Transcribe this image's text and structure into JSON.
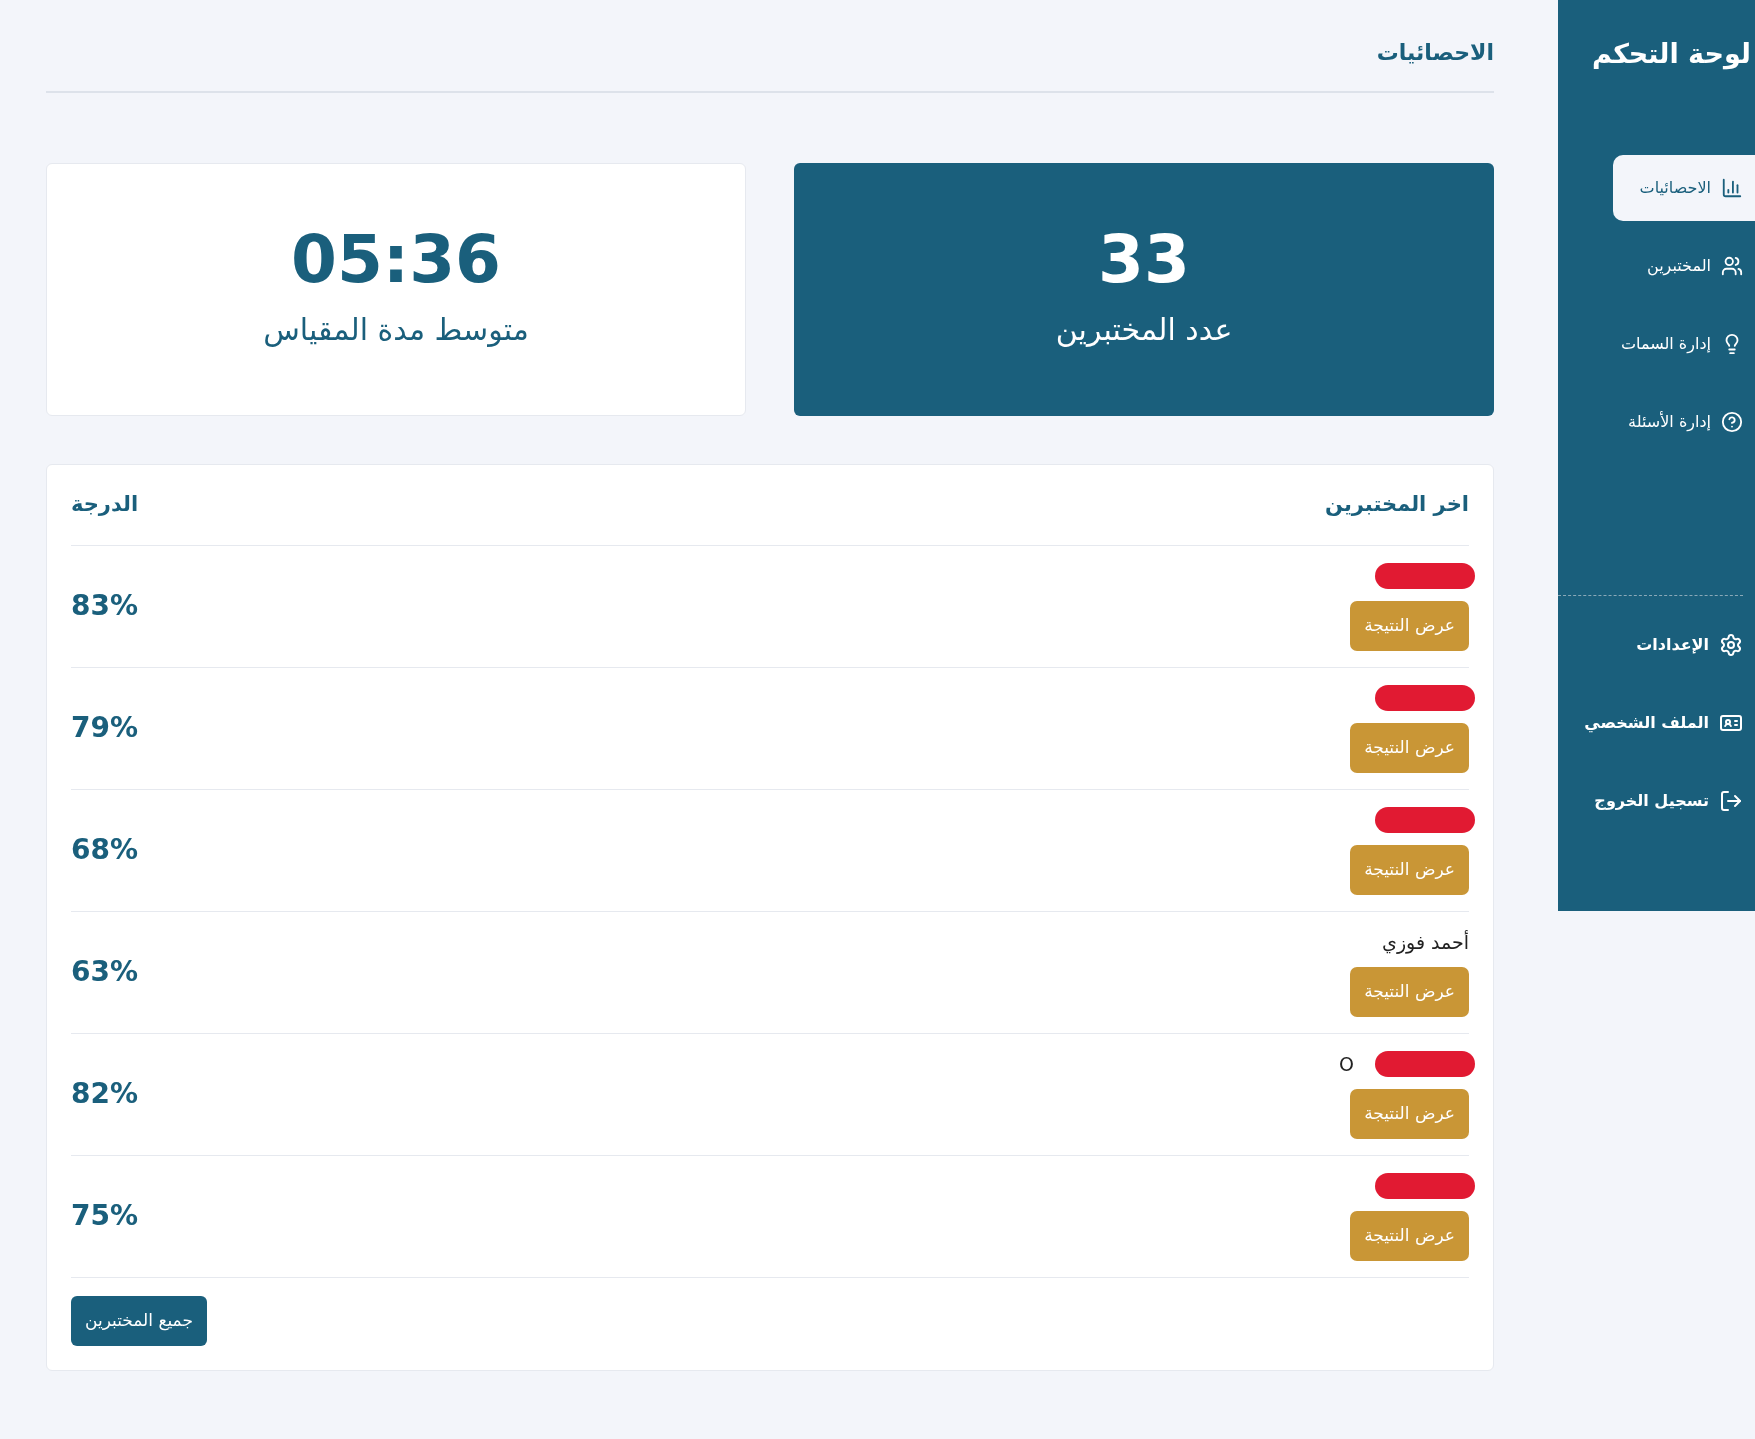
{
  "sidebar": {
    "title": "لوحة التحكم",
    "items": [
      {
        "label": "الاحصائيات",
        "selected": true
      },
      {
        "label": "المختبرين",
        "selected": false
      },
      {
        "label": "إدارة السمات",
        "selected": false
      },
      {
        "label": "إدارة الأسئلة",
        "selected": false
      }
    ],
    "bottom_items": [
      {
        "label": "الإعدادات"
      },
      {
        "label": "الملف الشخصي"
      },
      {
        "label": "تسجيل الخروج"
      }
    ]
  },
  "header": {
    "title": "الاحصائيات"
  },
  "stats": [
    {
      "value": "33",
      "label": "عدد المختبرين",
      "highlighted": true
    },
    {
      "value": "05:36",
      "label": "متوسط مدة المقياس",
      "highlighted": false
    }
  ],
  "table": {
    "columns": [
      "اخر المختبرين",
      "الدرجة"
    ],
    "rows": [
      {
        "name": "",
        "redacted": true,
        "action": "عرض النتيجة",
        "score": "83%"
      },
      {
        "name": "",
        "redacted": true,
        "action": "عرض النتيجة",
        "score": "79%"
      },
      {
        "name": "",
        "redacted": true,
        "action": "عرض النتيجة",
        "score": "68%"
      },
      {
        "name": "أحمد فوزي",
        "redacted": false,
        "action": "عرض النتيجة",
        "score": "63%"
      },
      {
        "name": "O",
        "redacted": true,
        "action": "عرض النتيجة",
        "score": "82%"
      },
      {
        "name": "",
        "redacted": true,
        "action": "عرض النتيجة",
        "score": "75%"
      }
    ],
    "footer_button": "جميع المختبرين"
  }
}
